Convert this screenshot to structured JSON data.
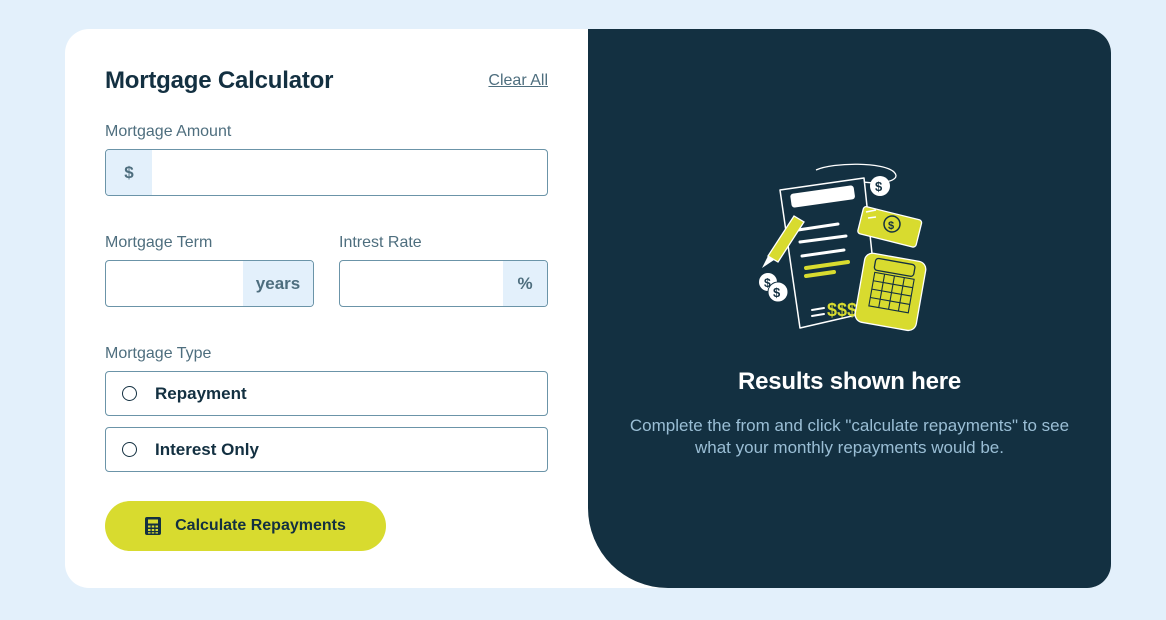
{
  "form": {
    "title": "Mortgage Calculator",
    "clear_all": "Clear All",
    "amount": {
      "label": "Mortgage Amount",
      "prefix": "$",
      "value": ""
    },
    "term": {
      "label": "Mortgage Term",
      "suffix": "years",
      "value": ""
    },
    "rate": {
      "label": "Intrest Rate",
      "suffix": "%",
      "value": ""
    },
    "type": {
      "label": "Mortgage Type",
      "options": [
        "Repayment",
        "Interest Only"
      ],
      "selected": null
    },
    "submit_label": "Calculate Repayments"
  },
  "results": {
    "title": "Results shown here",
    "description": "Complete the from and click \"calculate repayments\" to see what your monthly repayments would be."
  },
  "icons": {
    "calculator": "calculator-icon",
    "illustration": "empty-results-illustration"
  },
  "colors": {
    "accent": "#d8db2f",
    "dark": "#133041",
    "background": "#e3f0fb",
    "muted_text": "#4e6e7e"
  }
}
